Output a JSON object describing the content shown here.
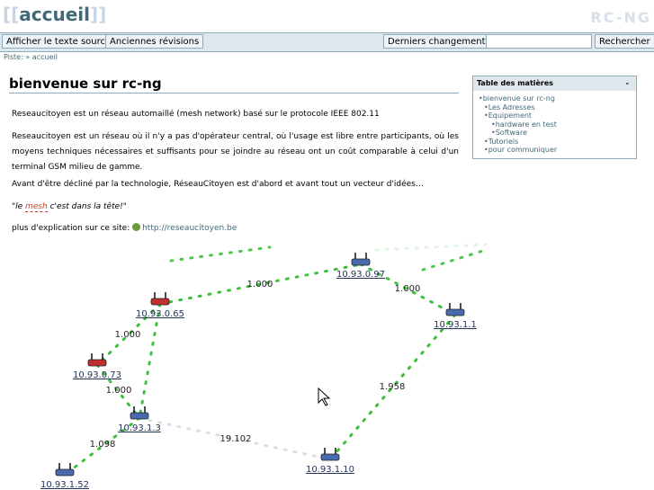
{
  "header": {
    "logo_prefix": "[[",
    "logo_word": "accueil",
    "logo_suffix": "]]",
    "brand": "RC-NG"
  },
  "toolbar": {
    "show_source": "Afficher le texte source",
    "old_revisions": "Anciennes révisions",
    "recent_changes": "Derniers changements",
    "search_value": "",
    "search_button": "Rechercher"
  },
  "breadcrumb": {
    "label": "Piste:",
    "separator": "»",
    "item": "accueil"
  },
  "page": {
    "title": "bienvenue sur rc-ng",
    "p1": "Reseaucitoyen est un réseau automaillé (mesh network) basé sur le protocole IEEE 802.11",
    "p2": "Reseaucitoyen est un réseau où il n'y a pas d'opérateur central, où l'usage est libre entre participants, où les moyens techniques nécessaires et suffisants pour se joindre au réseau ont un coût comparable à celui d'un terminal GSM milieu de gamme.",
    "p3": "Avant d'être décliné par la technologie, RéseauCitoyen est d'abord et avant tout un vecteur d'idées…",
    "quote_pre": "\"le ",
    "quote_word": "mesh",
    "quote_post": " c'est dans la tête!\"",
    "link_prefix": "plus d'explication sur ce site: ",
    "link_text": "http://reseaucitoyen.be"
  },
  "toc": {
    "title": "Table des matières",
    "toggle": "-",
    "items": [
      "bienvenue sur rc-ng",
      "Les Adresses",
      "Equipement",
      "hardware en test",
      "Software",
      "Tutoriels",
      "pour communiquer"
    ]
  },
  "chart_data": {
    "type": "network",
    "nodes": [
      "10.93.0.97",
      "10.93.0.65",
      "10.93.1.1",
      "10.93.0.73",
      "10.93.1.3",
      "10.93.1.52",
      "10.93.1.10"
    ],
    "links": [
      {
        "from": "10.93.0.65",
        "to": "10.93.0.97",
        "label": "1.000"
      },
      {
        "from": "10.93.0.97",
        "to": "10.93.1.1",
        "label": "1.000"
      },
      {
        "from": "10.93.0.65",
        "to": "10.93.0.73",
        "label": "1.000"
      },
      {
        "from": "10.93.0.65",
        "to": "10.93.1.3",
        "label": ""
      },
      {
        "from": "10.93.0.73",
        "to": "10.93.1.3",
        "label": "1.000"
      },
      {
        "from": "10.93.1.1",
        "to": "10.93.1.10",
        "label": "1.958"
      },
      {
        "from": "10.93.1.3",
        "to": "10.93.1.10",
        "label": "19.102"
      },
      {
        "from": "10.93.1.3",
        "to": "10.93.1.52",
        "label": "1.098"
      }
    ]
  }
}
